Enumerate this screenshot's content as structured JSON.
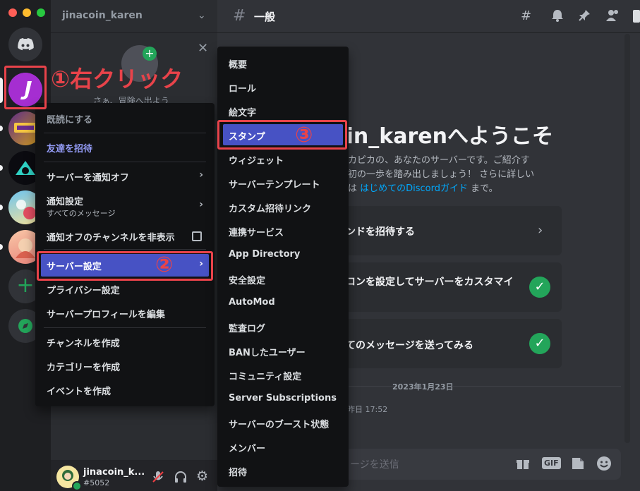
{
  "app": {
    "traffic_colors": [
      "#ff5f57",
      "#febc2e",
      "#28c840"
    ]
  },
  "guild": {
    "name": "jinacoin_karen"
  },
  "channel": {
    "name": "一般"
  },
  "sidebar_peek": {
    "text": "さぁ、冒険へ出よう"
  },
  "welcome": {
    "title_partial": "oin_karenへようこそ",
    "line1": "ピカピカの、あなたのサーバーです。ご紹介す",
    "line2": "最初の一歩を踏み出しましょう！ さらに詳しい",
    "line3_prefix": "報は ",
    "guide_link": "はじめてのDiscordガイド",
    "line3_suffix": " まで。"
  },
  "cards": [
    {
      "text": "ンドを招待する"
    },
    {
      "text": "コンを設定してサーバーをカスタマイ"
    },
    {
      "text": "てのメッセージを送ってみる"
    }
  ],
  "divider_date": "2023年1月23日",
  "message_time": "昨日 17:52",
  "composer_placeholder": "ージを送信",
  "composer_icons": {
    "gif": "GIF"
  },
  "user": {
    "name": "jinacoin_k...",
    "tag": "#5052"
  },
  "context_menu": {
    "mark_read": "既読にする",
    "invite": "友達を招待",
    "mute": "サーバーを通知オフ",
    "notify": "通知設定",
    "notify_sub": "すべてのメッセージ",
    "hide_muted": "通知オフのチャンネルを非表示",
    "server_settings": "サーバー設定",
    "privacy": "プライバシー設定",
    "edit_profile": "サーバープロフィールを編集",
    "create_channel": "チャンネルを作成",
    "create_category": "カテゴリーを作成",
    "create_event": "イベントを作成"
  },
  "submenu": {
    "items": [
      "概要",
      "ロール",
      "絵文字",
      "スタンプ",
      "ウィジェット",
      "サーバーテンプレート",
      "カスタム招待リンク",
      "連携サービス",
      "App Directory",
      "安全設定",
      "AutoMod",
      "監査ログ",
      "BANしたユーザー",
      "コミュニティ設定",
      "Server Subscriptions",
      "サーバーのブースト状態",
      "メンバー",
      "招待"
    ],
    "highlighted_index": 3
  },
  "annotations": {
    "step1": "①",
    "step1_text": "右クリック",
    "step2": "②",
    "step3": "③"
  },
  "colors": {
    "accent": "#5865f2",
    "annotation": "#e8434a",
    "green": "#23a55a",
    "link": "#00a8fc"
  }
}
